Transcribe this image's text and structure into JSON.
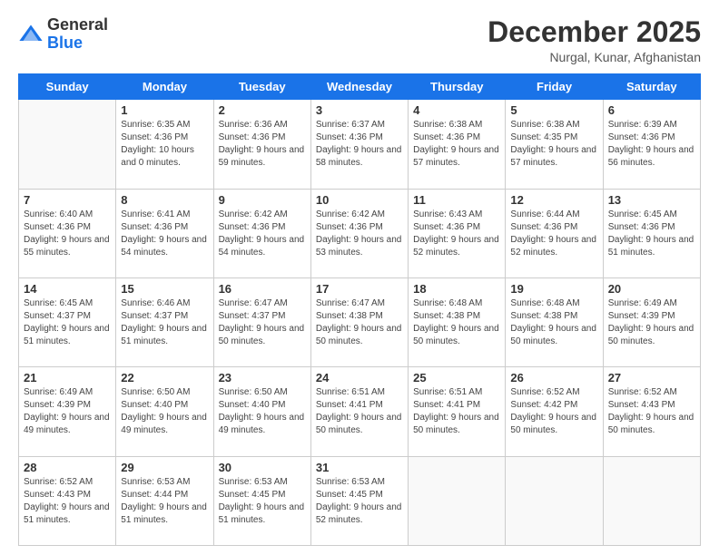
{
  "logo": {
    "general": "General",
    "blue": "Blue"
  },
  "header": {
    "month": "December 2025",
    "location": "Nurgal, Kunar, Afghanistan"
  },
  "days_of_week": [
    "Sunday",
    "Monday",
    "Tuesday",
    "Wednesday",
    "Thursday",
    "Friday",
    "Saturday"
  ],
  "weeks": [
    [
      {
        "day": "",
        "sunrise": "",
        "sunset": "",
        "daylight": ""
      },
      {
        "day": "1",
        "sunrise": "Sunrise: 6:35 AM",
        "sunset": "Sunset: 4:36 PM",
        "daylight": "Daylight: 10 hours and 0 minutes."
      },
      {
        "day": "2",
        "sunrise": "Sunrise: 6:36 AM",
        "sunset": "Sunset: 4:36 PM",
        "daylight": "Daylight: 9 hours and 59 minutes."
      },
      {
        "day": "3",
        "sunrise": "Sunrise: 6:37 AM",
        "sunset": "Sunset: 4:36 PM",
        "daylight": "Daylight: 9 hours and 58 minutes."
      },
      {
        "day": "4",
        "sunrise": "Sunrise: 6:38 AM",
        "sunset": "Sunset: 4:36 PM",
        "daylight": "Daylight: 9 hours and 57 minutes."
      },
      {
        "day": "5",
        "sunrise": "Sunrise: 6:38 AM",
        "sunset": "Sunset: 4:35 PM",
        "daylight": "Daylight: 9 hours and 57 minutes."
      },
      {
        "day": "6",
        "sunrise": "Sunrise: 6:39 AM",
        "sunset": "Sunset: 4:36 PM",
        "daylight": "Daylight: 9 hours and 56 minutes."
      }
    ],
    [
      {
        "day": "7",
        "sunrise": "Sunrise: 6:40 AM",
        "sunset": "Sunset: 4:36 PM",
        "daylight": "Daylight: 9 hours and 55 minutes."
      },
      {
        "day": "8",
        "sunrise": "Sunrise: 6:41 AM",
        "sunset": "Sunset: 4:36 PM",
        "daylight": "Daylight: 9 hours and 54 minutes."
      },
      {
        "day": "9",
        "sunrise": "Sunrise: 6:42 AM",
        "sunset": "Sunset: 4:36 PM",
        "daylight": "Daylight: 9 hours and 54 minutes."
      },
      {
        "day": "10",
        "sunrise": "Sunrise: 6:42 AM",
        "sunset": "Sunset: 4:36 PM",
        "daylight": "Daylight: 9 hours and 53 minutes."
      },
      {
        "day": "11",
        "sunrise": "Sunrise: 6:43 AM",
        "sunset": "Sunset: 4:36 PM",
        "daylight": "Daylight: 9 hours and 52 minutes."
      },
      {
        "day": "12",
        "sunrise": "Sunrise: 6:44 AM",
        "sunset": "Sunset: 4:36 PM",
        "daylight": "Daylight: 9 hours and 52 minutes."
      },
      {
        "day": "13",
        "sunrise": "Sunrise: 6:45 AM",
        "sunset": "Sunset: 4:36 PM",
        "daylight": "Daylight: 9 hours and 51 minutes."
      }
    ],
    [
      {
        "day": "14",
        "sunrise": "Sunrise: 6:45 AM",
        "sunset": "Sunset: 4:37 PM",
        "daylight": "Daylight: 9 hours and 51 minutes."
      },
      {
        "day": "15",
        "sunrise": "Sunrise: 6:46 AM",
        "sunset": "Sunset: 4:37 PM",
        "daylight": "Daylight: 9 hours and 51 minutes."
      },
      {
        "day": "16",
        "sunrise": "Sunrise: 6:47 AM",
        "sunset": "Sunset: 4:37 PM",
        "daylight": "Daylight: 9 hours and 50 minutes."
      },
      {
        "day": "17",
        "sunrise": "Sunrise: 6:47 AM",
        "sunset": "Sunset: 4:38 PM",
        "daylight": "Daylight: 9 hours and 50 minutes."
      },
      {
        "day": "18",
        "sunrise": "Sunrise: 6:48 AM",
        "sunset": "Sunset: 4:38 PM",
        "daylight": "Daylight: 9 hours and 50 minutes."
      },
      {
        "day": "19",
        "sunrise": "Sunrise: 6:48 AM",
        "sunset": "Sunset: 4:38 PM",
        "daylight": "Daylight: 9 hours and 50 minutes."
      },
      {
        "day": "20",
        "sunrise": "Sunrise: 6:49 AM",
        "sunset": "Sunset: 4:39 PM",
        "daylight": "Daylight: 9 hours and 50 minutes."
      }
    ],
    [
      {
        "day": "21",
        "sunrise": "Sunrise: 6:49 AM",
        "sunset": "Sunset: 4:39 PM",
        "daylight": "Daylight: 9 hours and 49 minutes."
      },
      {
        "day": "22",
        "sunrise": "Sunrise: 6:50 AM",
        "sunset": "Sunset: 4:40 PM",
        "daylight": "Daylight: 9 hours and 49 minutes."
      },
      {
        "day": "23",
        "sunrise": "Sunrise: 6:50 AM",
        "sunset": "Sunset: 4:40 PM",
        "daylight": "Daylight: 9 hours and 49 minutes."
      },
      {
        "day": "24",
        "sunrise": "Sunrise: 6:51 AM",
        "sunset": "Sunset: 4:41 PM",
        "daylight": "Daylight: 9 hours and 50 minutes."
      },
      {
        "day": "25",
        "sunrise": "Sunrise: 6:51 AM",
        "sunset": "Sunset: 4:41 PM",
        "daylight": "Daylight: 9 hours and 50 minutes."
      },
      {
        "day": "26",
        "sunrise": "Sunrise: 6:52 AM",
        "sunset": "Sunset: 4:42 PM",
        "daylight": "Daylight: 9 hours and 50 minutes."
      },
      {
        "day": "27",
        "sunrise": "Sunrise: 6:52 AM",
        "sunset": "Sunset: 4:43 PM",
        "daylight": "Daylight: 9 hours and 50 minutes."
      }
    ],
    [
      {
        "day": "28",
        "sunrise": "Sunrise: 6:52 AM",
        "sunset": "Sunset: 4:43 PM",
        "daylight": "Daylight: 9 hours and 51 minutes."
      },
      {
        "day": "29",
        "sunrise": "Sunrise: 6:53 AM",
        "sunset": "Sunset: 4:44 PM",
        "daylight": "Daylight: 9 hours and 51 minutes."
      },
      {
        "day": "30",
        "sunrise": "Sunrise: 6:53 AM",
        "sunset": "Sunset: 4:45 PM",
        "daylight": "Daylight: 9 hours and 51 minutes."
      },
      {
        "day": "31",
        "sunrise": "Sunrise: 6:53 AM",
        "sunset": "Sunset: 4:45 PM",
        "daylight": "Daylight: 9 hours and 52 minutes."
      },
      {
        "day": "",
        "sunrise": "",
        "sunset": "",
        "daylight": ""
      },
      {
        "day": "",
        "sunrise": "",
        "sunset": "",
        "daylight": ""
      },
      {
        "day": "",
        "sunrise": "",
        "sunset": "",
        "daylight": ""
      }
    ]
  ]
}
